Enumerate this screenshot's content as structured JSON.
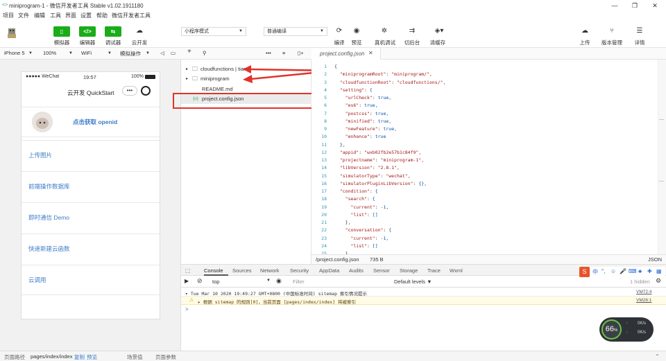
{
  "window": {
    "title": "miniprogram-1 - 微信开发者工具 Stable v1.02.1911180",
    "minimize": "—",
    "maximize": "❐",
    "close": "✕"
  },
  "menu": [
    "项目",
    "文件",
    "编辑",
    "工具",
    "界面",
    "设置",
    "帮助",
    "微信开发者工具"
  ],
  "toolbar": {
    "simulator": "模拟器",
    "editor": "编辑器",
    "debugger": "调试器",
    "cloud": "云开发",
    "mode_select": "小程序模式",
    "compile_select": "普通编译",
    "compile": "编译",
    "preview": "预览",
    "real_debug": "真机调试",
    "bg": "切后台",
    "cache": "清缓存",
    "upload": "上传",
    "version": "版本管理",
    "details": "详情"
  },
  "subbar": {
    "device": "iPhone 5",
    "zoom": "100%",
    "network": "WiFi",
    "action": "模拟操作"
  },
  "phone": {
    "carrier": "●●●●● WeChat",
    "wifi_icon": "wifi-icon",
    "time": "19:57",
    "battery": "100%",
    "nav_title": "云开发 QuickStart",
    "openid": "点击获取 openid",
    "items": [
      "上传图片",
      "前端操作数据库",
      "即时通信 Demo",
      "快速新建云函数",
      "云调用"
    ]
  },
  "tree": [
    {
      "icon": "▸",
      "label": "cloudfunctions | tian"
    },
    {
      "icon": "▸",
      "label": "miniprogram"
    },
    {
      "icon": "",
      "label": "README.md"
    },
    {
      "icon": "{o}",
      "label": "project.config.json"
    }
  ],
  "editor": {
    "tab": "project.config.json",
    "lines": [
      "{",
      "  \"miniprogramRoot\": \"miniprogram/\",",
      "  \"cloudfunctionRoot\": \"cloudfunctions/\",",
      "  \"setting\": {",
      "    \"urlCheck\": true,",
      "    \"es6\": true,",
      "    \"postcss\": true,",
      "    \"minified\": true,",
      "    \"newFeature\": true,",
      "    \"enhance\": true",
      "  },",
      "  \"appid\": \"wxb02fb2e57b1c84f9\",",
      "  \"projectname\": \"miniprogram-1\",",
      "  \"libVersion\": \"2.8.1\",",
      "  \"simulatorType\": \"wechat\",",
      "  \"simulatorPluginLibVersion\": {},",
      "  \"condition\": {",
      "    \"search\": {",
      "      \"current\": -1,",
      "      \"list\": []",
      "    },",
      "    \"conversation\": {",
      "      \"current\": -1,",
      "      \"list\": []",
      "    },"
    ],
    "status_path": "/project.config.json",
    "status_size": "735 B",
    "status_lang": "JSON"
  },
  "console": {
    "tabs": [
      "Console",
      "Sources",
      "Network",
      "Security",
      "AppData",
      "Audits",
      "Sensor",
      "Storage",
      "Trace",
      "Wxml"
    ],
    "context": "top",
    "filter": "Filter",
    "levels": "Default levels ▼",
    "hidden": "1 hidden",
    "log1": "▾ Tue Mar 10 2020 19:49:27 GMT+0800 (中国标准时间) sitemap 索引情况提示",
    "log1_src": "VM72:4",
    "log2": "▸ 根据 sitemap 的规则[0]，当前页面 [pages/index/index] 将被索引",
    "log2_src": "VM26:1",
    "prompt": ">"
  },
  "ime": [
    "中",
    "°,",
    "☺",
    "🎤",
    "⌨"
  ],
  "perf": {
    "value": "66",
    "unit": "%",
    "up": "0K/s",
    "down": "0K/s"
  },
  "footer": {
    "path_label": "页面路径",
    "path": "pages/index/index",
    "copy": "复制",
    "preview": "预览",
    "scene": "场景值",
    "params": "页面参数"
  }
}
